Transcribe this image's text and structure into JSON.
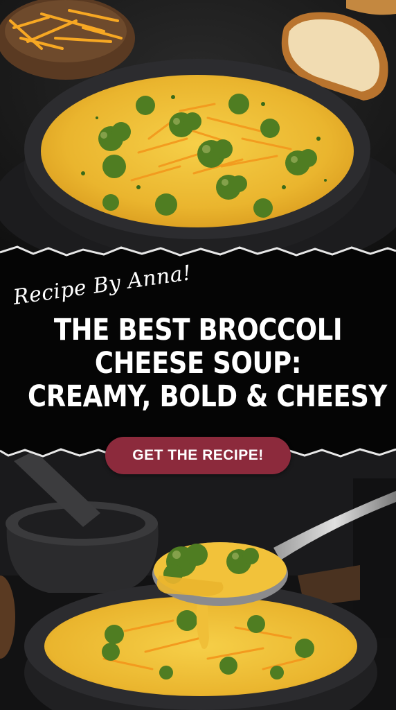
{
  "pin": {
    "script_text": "Recipe By Anna!",
    "headline_lines": [
      "THE BEST BROCCOLI",
      "CHEESE SOUP:",
      "CREAMY, BOLD & CHEESY"
    ],
    "cta_label": "GET THE RECIPE!"
  },
  "colors": {
    "background": "#141414",
    "banner": "#050505",
    "soup": "#f2c23a",
    "broccoli": "#4f7d22",
    "cheese": "#f39a1e",
    "cta": "#8c2a3c",
    "text": "#ffffff"
  }
}
